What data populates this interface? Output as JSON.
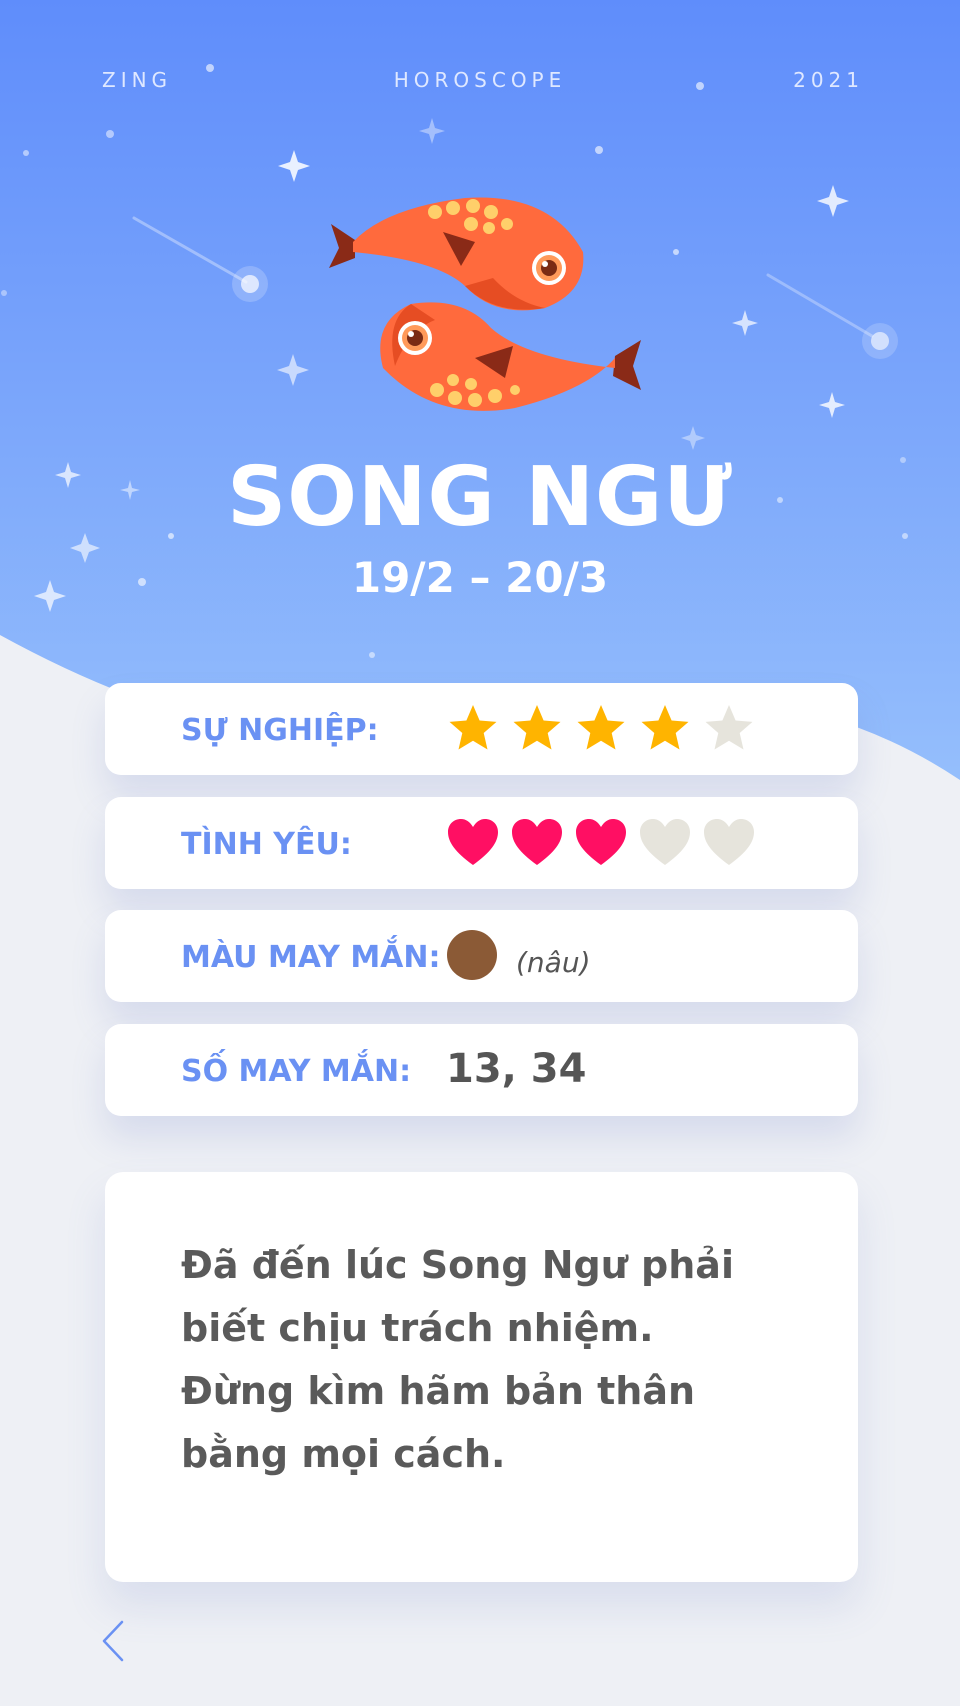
{
  "header": {
    "left": "ZING",
    "center": "HOROSCOPE",
    "right": "2021"
  },
  "sign": {
    "name": "SONG NGƯ",
    "dates": "19/2 – 20/3",
    "icon": "pisces-fish-icon"
  },
  "career": {
    "label": "SỰ NGHIỆP:",
    "rating": 4,
    "max": 5,
    "icon": "star-icon"
  },
  "love": {
    "label": "TÌNH YÊU:",
    "rating": 3,
    "max": 5,
    "icon": "heart-icon"
  },
  "lucky_color": {
    "label": "MÀU MAY MẮN:",
    "name": "(nâu)",
    "hex": "#8b5a36"
  },
  "lucky_number": {
    "label": "SỐ MAY MẮN:",
    "value": "13, 34"
  },
  "description": {
    "lines": [
      "Đã đến lúc Song Ngư phải",
      "biết chịu trách nhiệm.",
      "Đừng kìm hãm bản thân",
      "bằng mọi cách."
    ]
  },
  "colors": {
    "sky_top": "#5f8dfb",
    "sky_bottom": "#9dc6fc",
    "label": "#6a91f3",
    "star_on": "#ffb400",
    "star_off": "#e6e4dc",
    "heart_on": "#ff0f63",
    "heart_off": "#e6e4dc"
  },
  "nav": {
    "back_icon": "chevron-left-icon"
  }
}
